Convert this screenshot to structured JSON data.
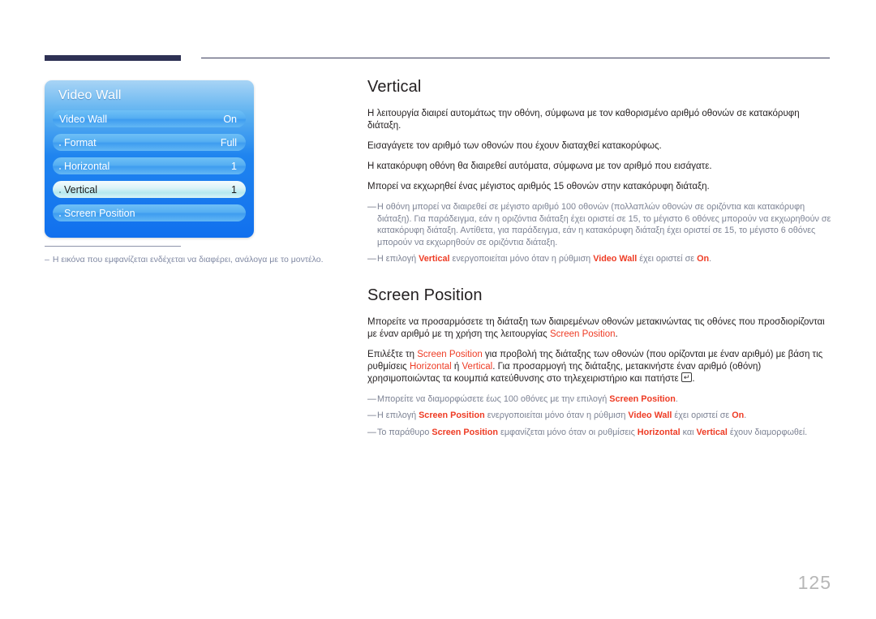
{
  "page": {
    "number": "125"
  },
  "osd": {
    "title": "Video Wall",
    "rows": [
      {
        "label": "Video Wall",
        "value": "On",
        "dot": false,
        "selected": false
      },
      {
        "label": "Format",
        "value": "Full",
        "dot": true,
        "selected": false
      },
      {
        "label": "Horizontal",
        "value": "1",
        "dot": true,
        "selected": false
      },
      {
        "label": "Vertical",
        "value": "1",
        "dot": true,
        "selected": true
      },
      {
        "label": "Screen Position",
        "value": "",
        "dot": true,
        "selected": false
      }
    ]
  },
  "left_note": {
    "dash": "–",
    "text": "Η εικόνα που εμφανίζεται ενδέχεται να διαφέρει, ανάλογα με το μοντέλο."
  },
  "sections": {
    "vertical": {
      "title": "Vertical",
      "paragraphs": [
        "Η λειτουργία διαιρεί αυτομάτως την οθόνη, σύμφωνα με τον καθορισμένο αριθμό οθονών σε κατακόρυφη διάταξη.",
        "Εισαγάγετε τον αριθμό των οθονών που έχουν διαταχθεί κατακορύφως.",
        "Η κατακόρυφη οθόνη θα διαιρεθεί αυτόματα, σύμφωνα με τον αριθμό που εισάγατε.",
        "Μπορεί να εκχωρηθεί ένας μέγιστος αριθμός 15 οθονών στην κατακόρυφη διάταξη."
      ],
      "notes": {
        "dash": "―",
        "note1": "Η οθόνη μπορεί να διαιρεθεί σε μέγιστο αριθμό 100 οθονών (πολλαπλών οθονών σε οριζόντια και κατακόρυφη διάταξη). Για παράδειγμα, εάν η οριζόντια διάταξη έχει οριστεί σε 15, το μέγιστο 6 οθόνες μπορούν να εκχωρηθούν σε κατακόρυφη διάταξη. Αντίθετα, για παράδειγμα, εάν η κατακόρυφη διάταξη έχει οριστεί σε 15, το μέγιστο 6 οθόνες μπορούν να εκχωρηθούν σε οριζόντια διάταξη.",
        "note2_a": "Η επιλογή ",
        "note2_hl1": "Vertical",
        "note2_b": " ενεργοποιείται μόνο όταν η ρύθμιση ",
        "note2_hl2": "Video Wall",
        "note2_c": " έχει οριστεί σε ",
        "note2_hl3": "On",
        "note2_d": "."
      }
    },
    "screen_position": {
      "title": "Screen Position",
      "p1_a": "Μπορείτε να προσαρμόσετε τη διάταξη των διαιρεμένων οθονών μετακινώντας τις οθόνες που προσδιορίζονται με έναν αριθμό με τη χρήση της λειτουργίας ",
      "p1_hl": "Screen Position",
      "p1_b": ".",
      "p2_a": "Επιλέξτε τη ",
      "p2_hl1": "Screen Position",
      "p2_b": " για προβολή της διάταξης των οθονών (που ορίζονται με έναν αριθμό) με βάση τις ρυθμίσεις ",
      "p2_hl2": "Horizontal",
      "p2_c": " ή ",
      "p2_hl3": "Vertical",
      "p2_d": ". Για προσαρμογή της διάταξης, μετακινήστε έναν αριθμό (οθόνη) χρησιμοποιώντας τα κουμπιά κατεύθυνσης στο τηλεχειριστήριο και πατήστε ",
      "p2_key": "↵",
      "p2_e": ".",
      "notes": {
        "dash": "―",
        "n1_a": "Μπορείτε να διαμορφώσετε έως 100 οθόνες με την επιλογή ",
        "n1_hl": "Screen Position",
        "n1_b": ".",
        "n2_a": "Η επιλογή ",
        "n2_hl1": "Screen Position",
        "n2_b": " ενεργοποιείται μόνο όταν η ρύθμιση ",
        "n2_hl2": "Video Wall",
        "n2_c": " έχει οριστεί σε ",
        "n2_hl3": "On",
        "n2_d": ".",
        "n3_a": "Το παράθυρο ",
        "n3_hl1": "Screen Position",
        "n3_b": " εμφανίζεται μόνο όταν οι ρυθμίσεις ",
        "n3_hl2": "Horizontal",
        "n3_c": " και ",
        "n3_hl3": "Vertical",
        "n3_d": " έχουν διαμορφωθεί."
      }
    }
  },
  "colors": {
    "accent": "#ee3b24",
    "heading": "#231f20",
    "note": "#7d8394",
    "panel_blue": "#1170ee",
    "rule_dark": "#2e3154"
  }
}
